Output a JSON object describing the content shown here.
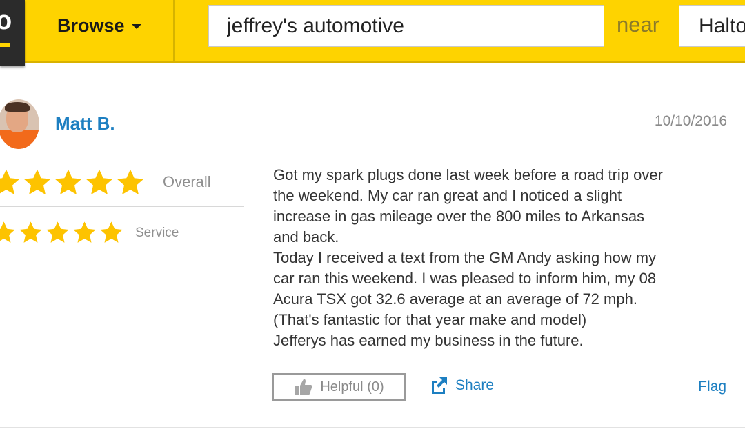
{
  "header": {
    "browse_label": "Browse",
    "search_value": "jeffrey's automotive",
    "near_label": "near",
    "location_value": "Halton"
  },
  "review": {
    "author": "Matt B.",
    "date": "10/10/2016",
    "ratings": [
      {
        "label": "Overall",
        "stars": 5,
        "max": 5
      },
      {
        "label": "Service",
        "stars": 5,
        "max": 5
      }
    ],
    "body_lines": [
      "Got my spark plugs done last week before a road trip over",
      "the weekend. My car ran great and I noticed a slight",
      "increase in gas mileage over the 800 miles to Arkansas",
      "and back.",
      "Today I received a text from the GM Andy asking how my",
      "car ran this weekend. I was pleased to inform him, my 08",
      "Acura TSX got 32.6 average at an average of 72 mph.",
      "(That's fantastic for that year make and model)",
      "Jefferys has earned my business in the future."
    ],
    "actions": {
      "helpful_label": "Helpful",
      "helpful_count": "(0)",
      "share_label": "Share",
      "flag_label": "Flag"
    }
  },
  "colors": {
    "brand_yellow": "#fed300",
    "link_blue": "#1d7fc1",
    "star_gold": "#fdc300"
  },
  "icons": {
    "caret": "chevron-down-icon",
    "helpful": "thumbs-up-icon",
    "share": "external-share-icon",
    "star": "star-icon"
  }
}
